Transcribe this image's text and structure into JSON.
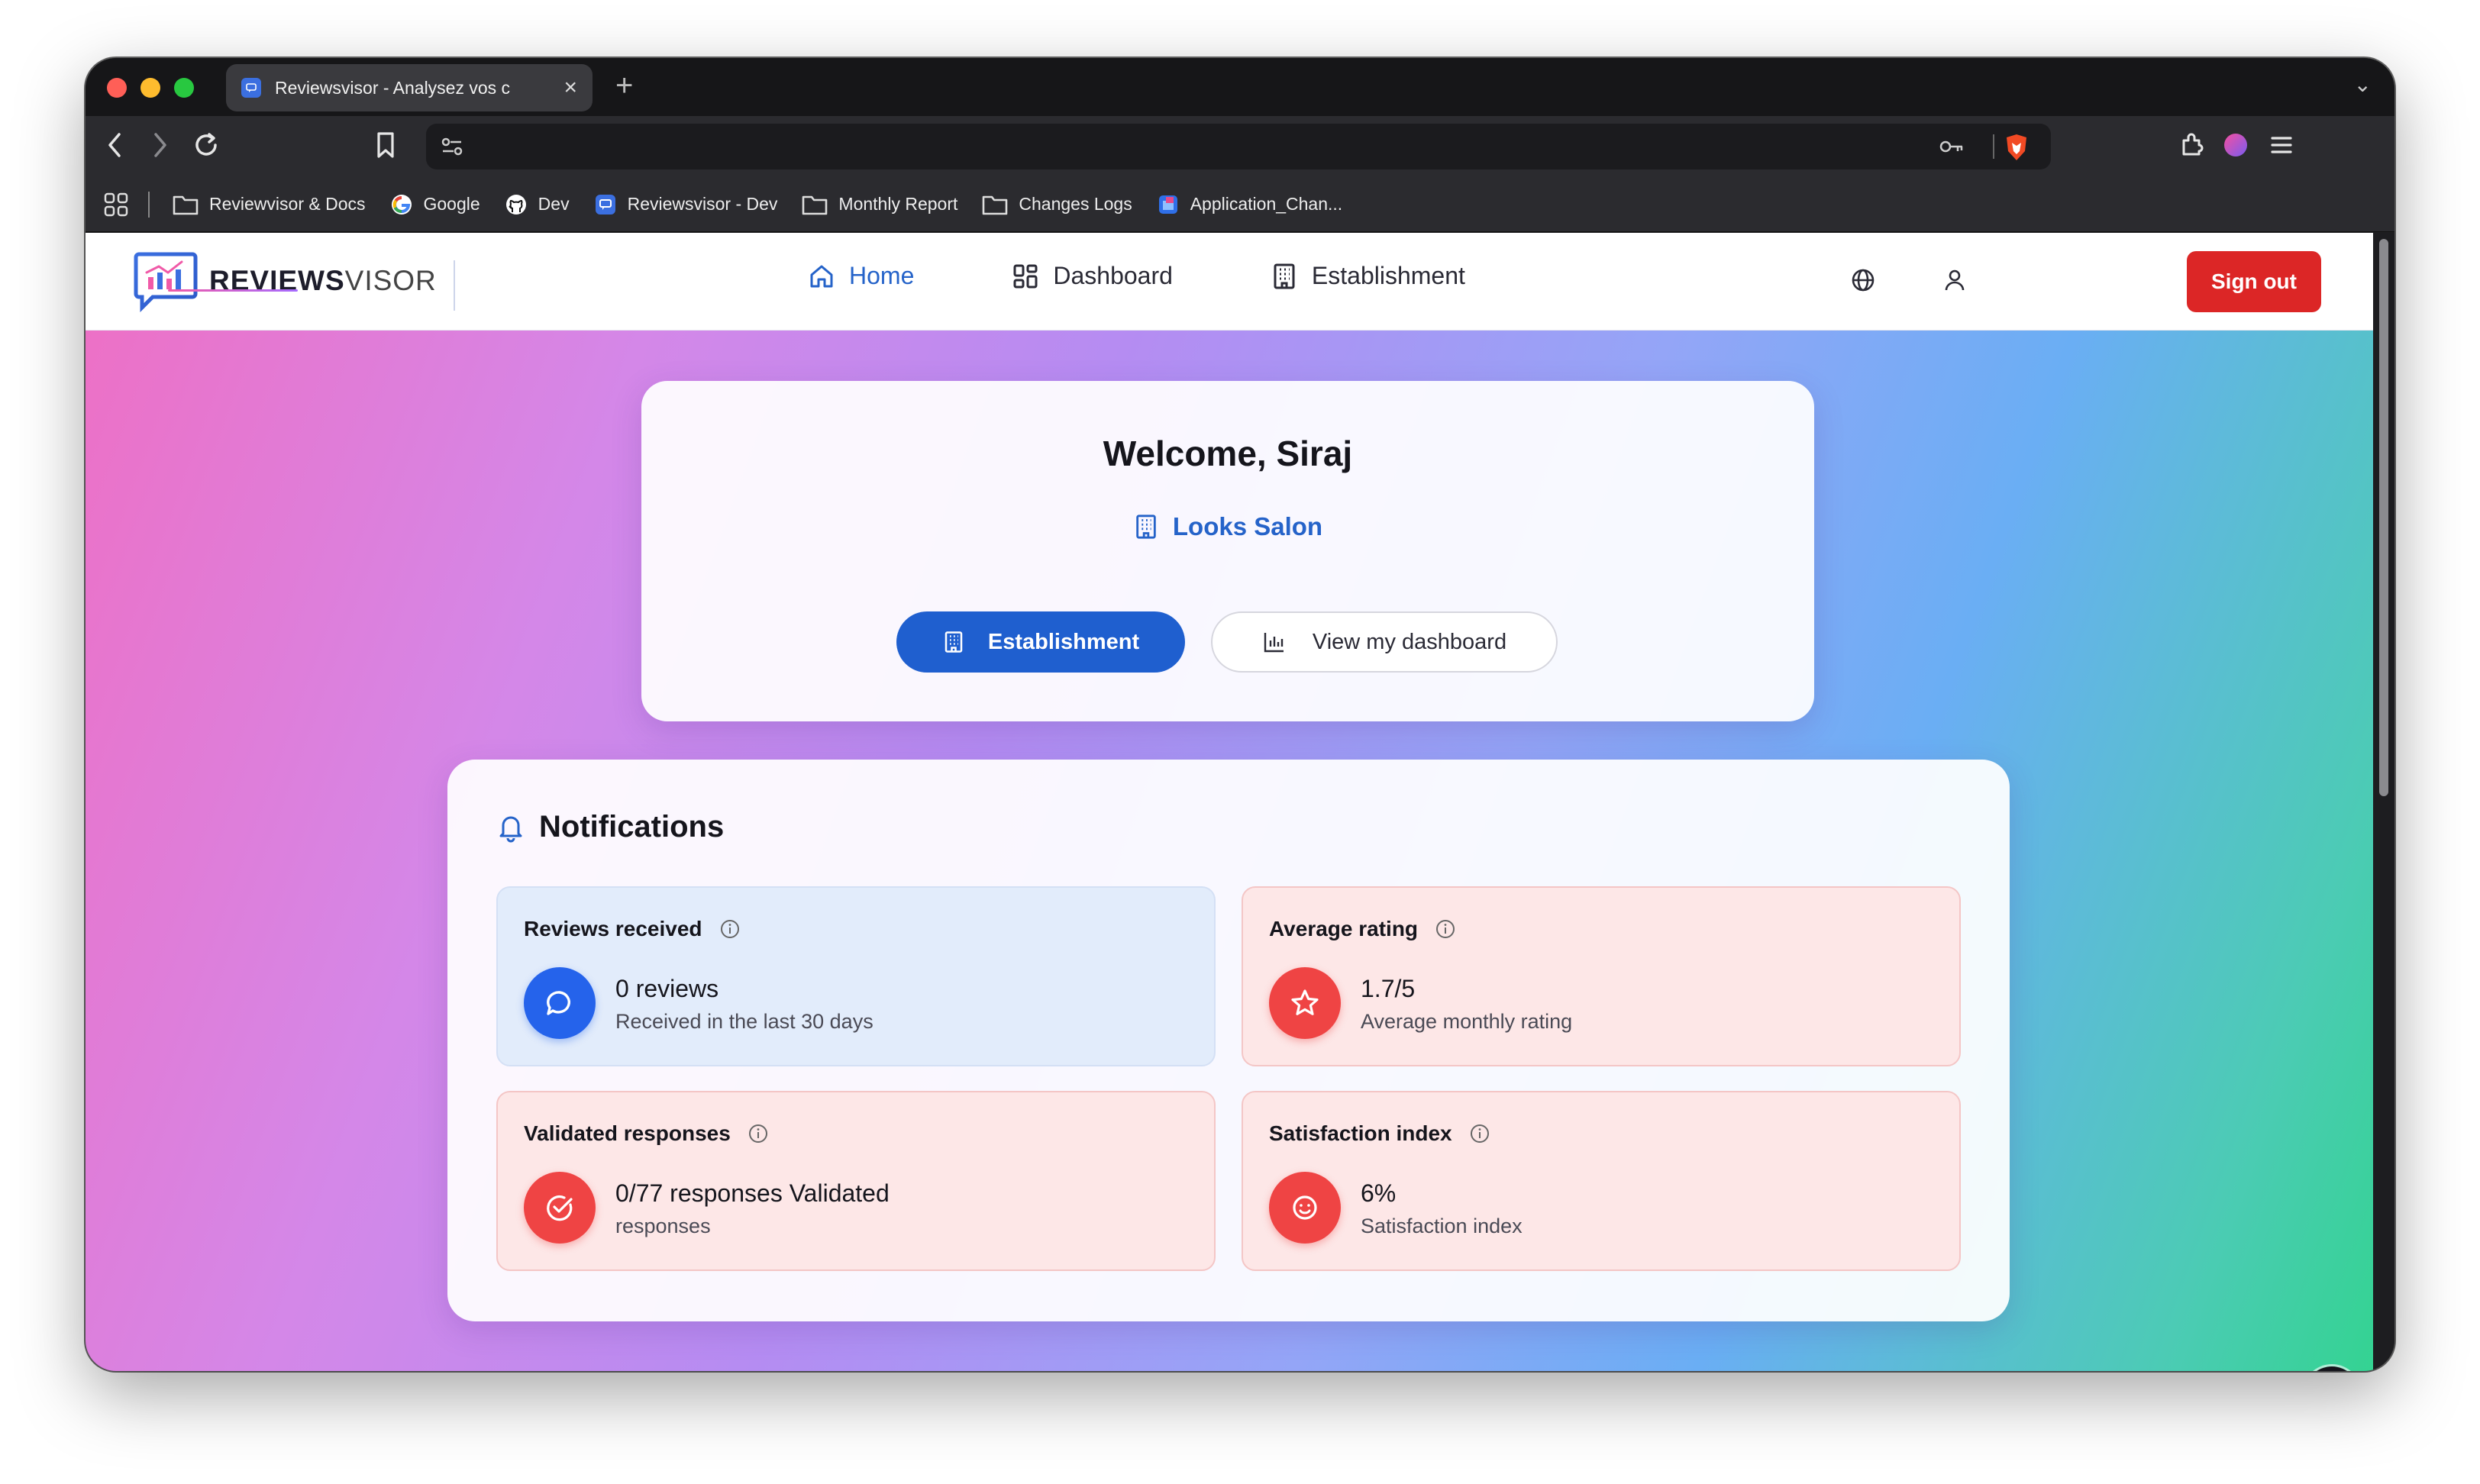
{
  "browser": {
    "tab_title": "Reviewsvisor - Analysez vos c",
    "bookmarks": [
      {
        "label": "Reviewvisor & Docs",
        "icon": "folder-icon"
      },
      {
        "label": "Google",
        "icon": "google-icon"
      },
      {
        "label": "Dev",
        "icon": "github-icon"
      },
      {
        "label": "Reviewsvisor - Dev",
        "icon": "reviewsvisor-favicon"
      },
      {
        "label": "Monthly Report",
        "icon": "folder-icon"
      },
      {
        "label": "Changes Logs",
        "icon": "folder-icon"
      },
      {
        "label": "Application_Chan...",
        "icon": "app-icon"
      }
    ]
  },
  "header": {
    "logo_bold": "REVIEWS",
    "logo_light": "VISOR",
    "nav": [
      {
        "label": "Home",
        "icon": "home-icon",
        "active": true
      },
      {
        "label": "Dashboard",
        "icon": "grid-icon",
        "active": false
      },
      {
        "label": "Establishment",
        "icon": "building-icon",
        "active": false
      }
    ],
    "sign_out": "Sign out"
  },
  "welcome": {
    "title": "Welcome, Siraj",
    "establishment_name": "Looks Salon",
    "establishment_button": "Establishment",
    "dashboard_button": "View my dashboard"
  },
  "notifications": {
    "title": "Notifications",
    "tiles": [
      {
        "title": "Reviews received",
        "value": "0 reviews",
        "subtitle": "Received in the last 30 days",
        "icon": "chat-bubble-icon",
        "color": "#2563eb"
      },
      {
        "title": "Average rating",
        "value": "1.7/5",
        "subtitle": "Average monthly rating",
        "icon": "star-icon",
        "color": "#ef4444"
      },
      {
        "title": "Validated responses",
        "value": "0/77 responses Validated",
        "subtitle": "responses",
        "icon": "check-circle-icon",
        "color": "#ef4444"
      },
      {
        "title": "Satisfaction index",
        "value": "6%",
        "subtitle": "Satisfaction index",
        "icon": "smile-icon",
        "color": "#ef4444"
      }
    ]
  },
  "colors": {
    "accent": "#2563c9",
    "danger": "#dc2626"
  }
}
